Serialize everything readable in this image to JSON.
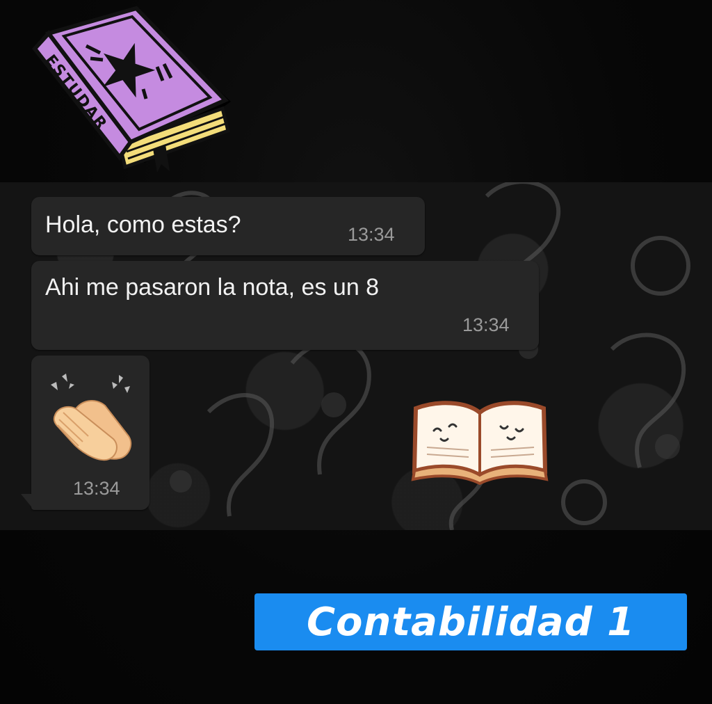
{
  "stickers": {
    "book_label": "ESTUDAR",
    "book_icon": "purple-book-star-icon",
    "open_book_icon": "open-book-smiling-icon"
  },
  "chat": {
    "messages": [
      {
        "text": "Hola, como estas?",
        "time": "13:34"
      },
      {
        "text": "Ahi me pasaron la nota, es un 8",
        "time": "13:34"
      },
      {
        "emoji": "clapping-hands-icon",
        "time": "13:34"
      }
    ]
  },
  "caption": {
    "text": "Contabilidad 1",
    "background": "#1a8cf0"
  },
  "colors": {
    "bubble": "#262626",
    "book_purple": "#c58be0",
    "book_pages": "#f3dd7a"
  }
}
